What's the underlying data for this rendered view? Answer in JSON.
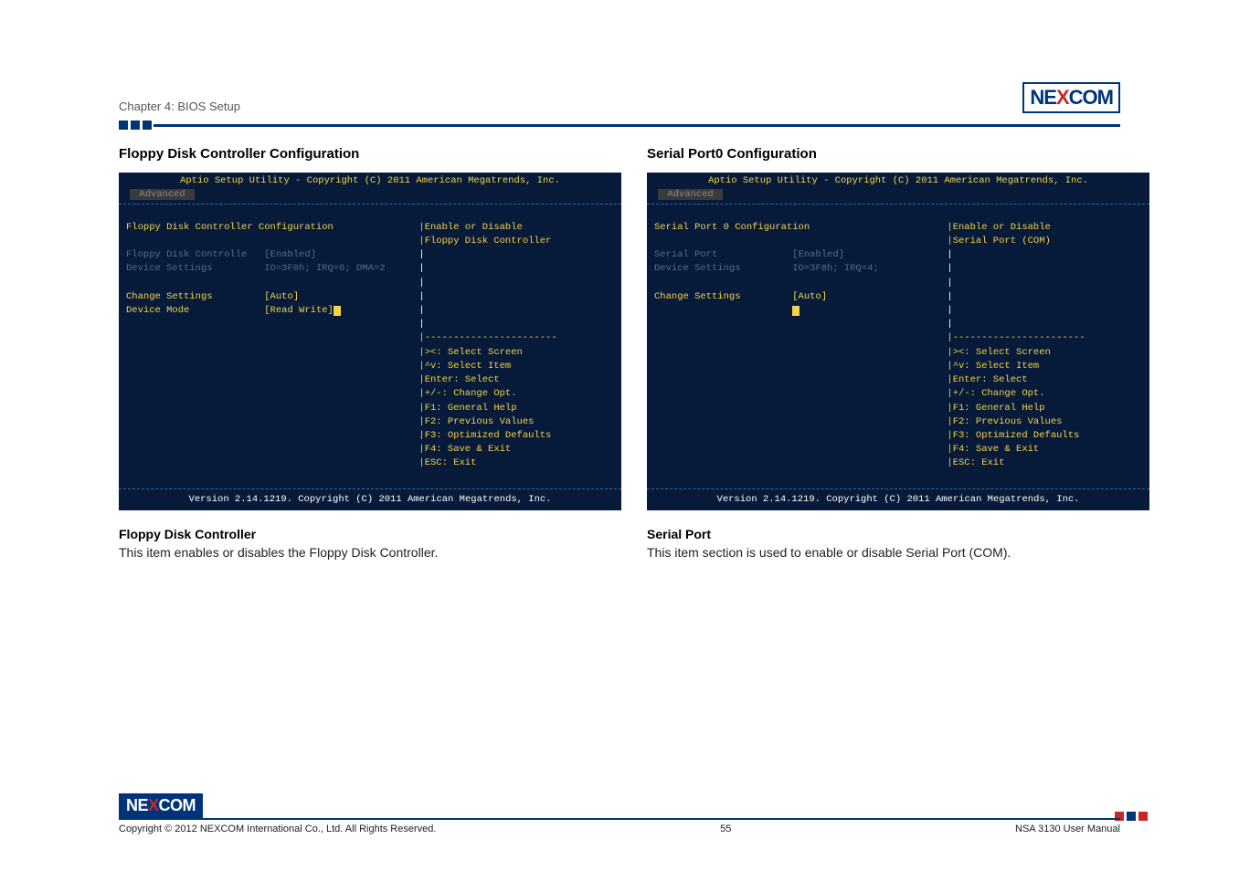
{
  "header": {
    "chapter": "Chapter 4: BIOS Setup",
    "brand_prefix": "NE",
    "brand_x": "X",
    "brand_suffix": "COM"
  },
  "left": {
    "title": "Floppy Disk Controller Configuration",
    "bios": {
      "header": "Aptio Setup Utility - Copyright (C) 2011 American Megatrends, Inc.",
      "tab": "Advanced",
      "section": "Floppy Disk Controller Configuration",
      "rows": [
        {
          "label": "Floppy Disk Controlle",
          "value": "[Enabled]",
          "highlight": true
        },
        {
          "label": "Device Settings",
          "value": "IO=3F0h; IRQ=6; DMA=2",
          "gray": true
        },
        {
          "label": "",
          "value": ""
        },
        {
          "label": "Change Settings",
          "value": "[Auto]"
        },
        {
          "label": "Device Mode",
          "value": "[Read Write]"
        }
      ],
      "help_top": [
        "Enable or Disable",
        "Floppy Disk Controller"
      ],
      "help_keys": [
        "><: Select Screen",
        "^v: Select Item",
        "Enter: Select",
        "+/-: Change Opt.",
        "F1: General Help",
        "F2: Previous Values",
        "F3: Optimized Defaults",
        "F4: Save & Exit",
        "ESC: Exit"
      ],
      "footer": "Version 2.14.1219. Copyright (C) 2011 American Megatrends, Inc."
    },
    "desc_title": "Floppy Disk Controller",
    "desc_body": "This item enables or disables the Floppy Disk Controller."
  },
  "right": {
    "title": "Serial Port0 Configuration",
    "bios": {
      "header": "Aptio Setup Utility - Copyright (C) 2011 American Megatrends, Inc.",
      "tab": "Advanced",
      "section": "Serial Port 0 Configuration",
      "rows": [
        {
          "label": "Serial Port",
          "value": "[Enabled]",
          "highlight": true
        },
        {
          "label": "Device Settings",
          "value": "IO=3F8h; IRQ=4;",
          "gray": true
        },
        {
          "label": "",
          "value": ""
        },
        {
          "label": "Change Settings",
          "value": "[Auto]"
        },
        {
          "label": "",
          "value": "",
          "cursor": true
        }
      ],
      "help_top": [
        "Enable or Disable",
        "Serial Port (COM)"
      ],
      "help_keys": [
        "><: Select Screen",
        "^v: Select Item",
        "Enter: Select",
        "+/-: Change Opt.",
        "F1: General Help",
        "F2: Previous Values",
        "F3: Optimized Defaults",
        "F4: Save & Exit",
        "ESC: Exit"
      ],
      "footer": "Version 2.14.1219. Copyright (C) 2011 American Megatrends, Inc."
    },
    "desc_title": "Serial Port",
    "desc_body": "This item section is used to enable or disable Serial Port (COM)."
  },
  "footer": {
    "copyright": "Copyright © 2012 NEXCOM International Co., Ltd. All Rights Reserved.",
    "page_number": "55",
    "doc_name": "NSA 3130 User Manual"
  }
}
